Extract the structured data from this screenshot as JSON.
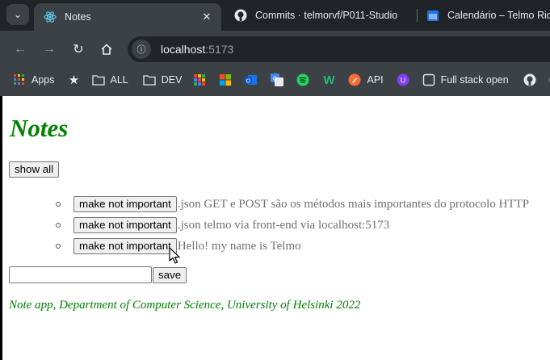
{
  "browser": {
    "tabs": [
      {
        "title": "Notes",
        "active": true,
        "icon": "react-icon"
      },
      {
        "title": "Commits · telmorvf/P011-Studio",
        "active": false,
        "icon": "github-icon"
      },
      {
        "title": "Calendário – Telmo Ricardo",
        "active": false,
        "icon": "outlook-calendar-icon"
      }
    ],
    "close_glyph": "✕",
    "address": {
      "host": "localhost",
      "port": ":5173"
    },
    "bookmarks": [
      {
        "label": "Apps",
        "icon": "apps-grid-icon"
      },
      {
        "label": "",
        "icon": "star-icon"
      },
      {
        "label": "ALL",
        "icon": "folder-icon"
      },
      {
        "label": "DEV",
        "icon": "folder-icon"
      },
      {
        "label": "",
        "icon": "colorful-grid-icon"
      },
      {
        "label": "",
        "icon": "microsoft-icon"
      },
      {
        "label": "",
        "icon": "outlook-icon"
      },
      {
        "label": "",
        "icon": "translate-icon"
      },
      {
        "label": "",
        "icon": "spotify-icon"
      },
      {
        "label": "",
        "icon": "w-icon"
      },
      {
        "label": "API",
        "icon": "postman-icon"
      },
      {
        "label": "",
        "icon": "u-icon"
      },
      {
        "label": "Full stack open",
        "icon": "fullstack-icon"
      },
      {
        "label": "",
        "icon": "github-icon"
      },
      {
        "label": "",
        "icon": "github-icon"
      }
    ]
  },
  "page": {
    "title": "Notes",
    "show_all_label": "show all",
    "notes": [
      {
        "button_label": "make not important",
        "content": ".json GET e POST são os métodos mais importantes do protocolo HTTP"
      },
      {
        "button_label": "make not important",
        "content": ".json telmo via front-end via localhost:5173"
      },
      {
        "button_label": "make not important",
        "content": "Hello! my name is Telmo"
      }
    ],
    "new_note_value": "",
    "save_label": "save",
    "footer": "Note app, Department of Computer Science, University of Helsinki 2022"
  },
  "colors": {
    "title_green": "#008000",
    "chrome_dark": "#202428",
    "chrome_mid": "#3b4145",
    "note_text": "#707070"
  }
}
